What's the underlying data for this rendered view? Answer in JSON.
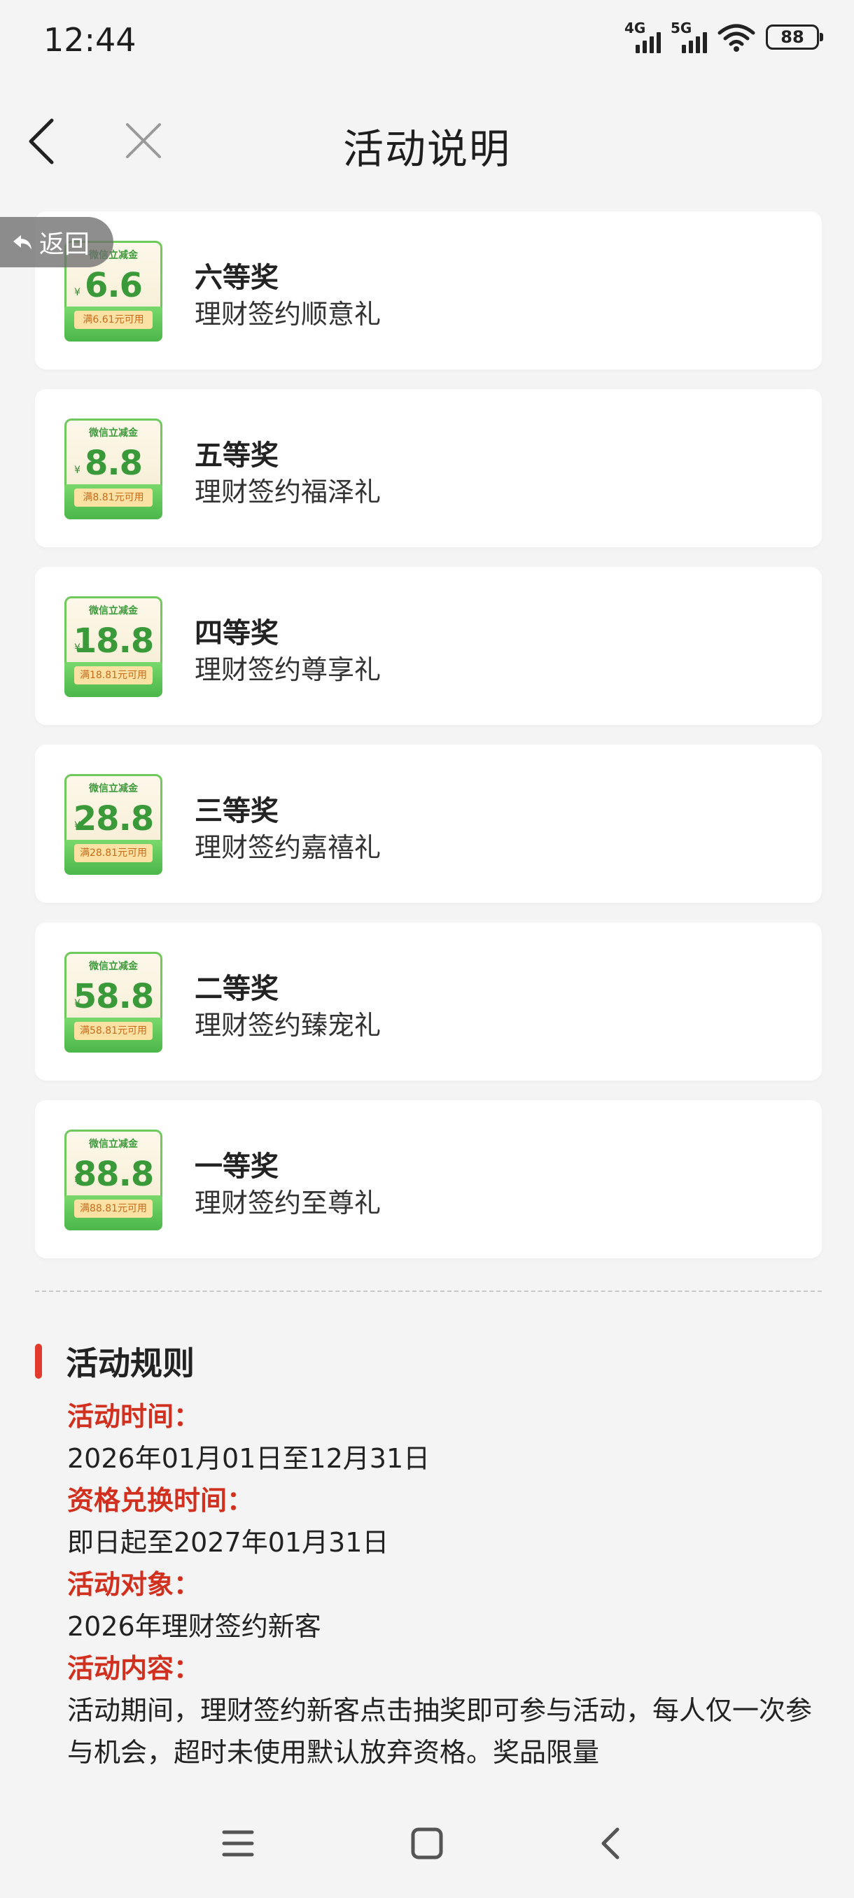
{
  "status_bar": {
    "time": "12:44",
    "net1": "4G",
    "net2": "5G",
    "battery": "88"
  },
  "nav": {
    "title": "活动说明",
    "back_icon": "chevron-left-icon",
    "close_icon": "close-icon"
  },
  "float_return": {
    "label": "返回",
    "icon": "return-arrow-icon"
  },
  "prizes": [
    {
      "coupon_top": "微信立减金",
      "amount": "6.6",
      "condition": "满6.61元可用",
      "title": "六等奖",
      "desc": "理财签约顺意礼"
    },
    {
      "coupon_top": "微信立减金",
      "amount": "8.8",
      "condition": "满8.81元可用",
      "title": "五等奖",
      "desc": "理财签约福泽礼"
    },
    {
      "coupon_top": "微信立减金",
      "amount": "18.8",
      "condition": "满18.81元可用",
      "title": "四等奖",
      "desc": "理财签约尊享礼"
    },
    {
      "coupon_top": "微信立减金",
      "amount": "28.8",
      "condition": "满28.81元可用",
      "title": "三等奖",
      "desc": "理财签约嘉禧礼"
    },
    {
      "coupon_top": "微信立减金",
      "amount": "58.8",
      "condition": "满58.81元可用",
      "title": "二等奖",
      "desc": "理财签约臻宠礼"
    },
    {
      "coupon_top": "微信立减金",
      "amount": "88.8",
      "condition": "满88.81元可用",
      "title": "一等奖",
      "desc": "理财签约至尊礼"
    }
  ],
  "rules": {
    "title": "活动规则",
    "items": [
      {
        "label": "活动时间：",
        "value": "2026年01月01日至12月31日"
      },
      {
        "label": "资格兑换时间：",
        "value": "即日起至2027年01月31日"
      },
      {
        "label": "活动对象：",
        "value": "2026年理财签约新客"
      },
      {
        "label": "活动内容：",
        "value": "活动期间，理财签约新客点击抽奖即可参与活动，每人仅一次参与机会，超时未使用默认放弃资格。奖品限量"
      }
    ]
  },
  "colors": {
    "accent_red": "#d2301f",
    "rule_bar": "#e33a2e",
    "coupon_green": "#4bb64a"
  },
  "system_nav": {
    "menu_icon": "menu-icon",
    "home_icon": "home-square-icon",
    "back_icon": "back-triangle-icon"
  }
}
